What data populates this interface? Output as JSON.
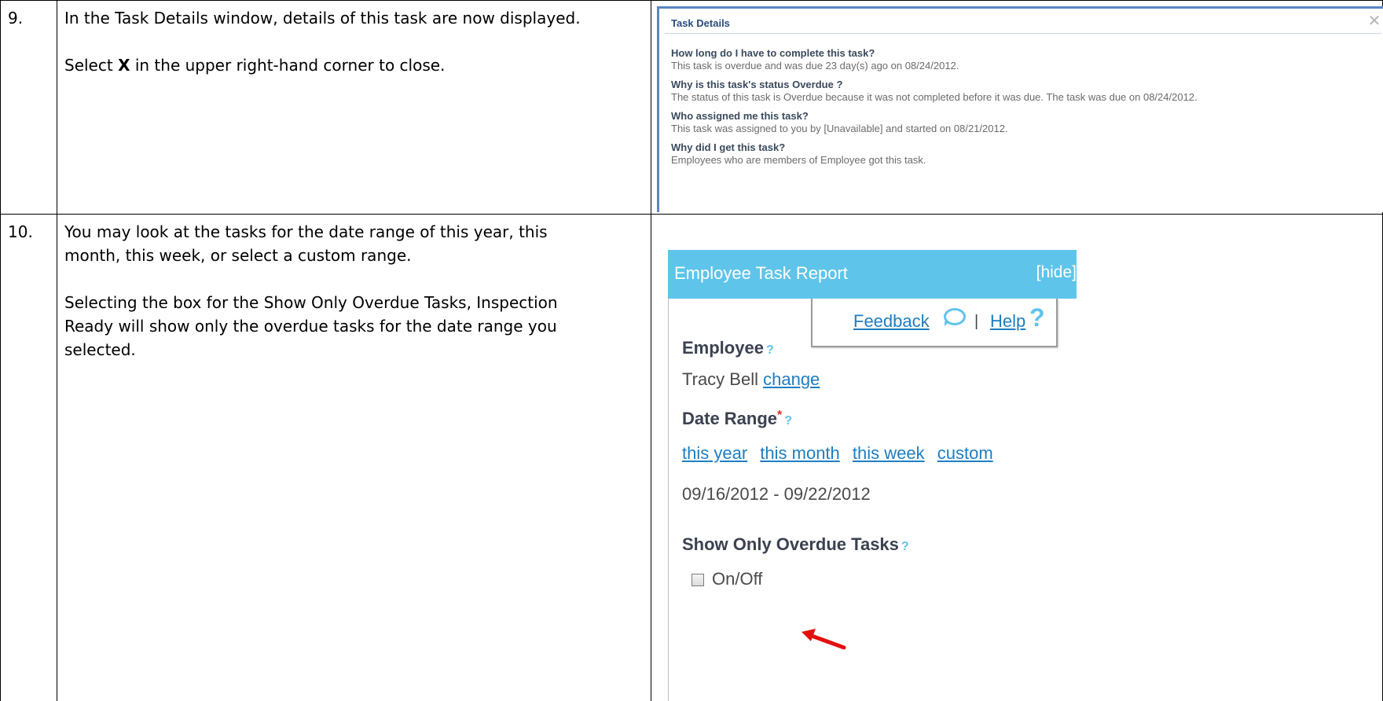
{
  "steps": [
    {
      "number": "9.",
      "paragraphs": [
        "In the Task Details window, details of this task are now displayed.",
        "in the upper right-hand corner to close."
      ],
      "bold_word": "X",
      "select_word": "Select"
    },
    {
      "number": "10.",
      "paragraphs": [
        "You may look at the tasks for the date range of this year, this month, this week, or select a custom range.",
        "Selecting the box for the Show Only Overdue Tasks, Inspection Ready will show only the overdue tasks for the date range you selected."
      ]
    }
  ],
  "task_details": {
    "title": "Task Details",
    "close_icon": "close-icon",
    "qa": [
      {
        "q": "How long do I have to complete this task?",
        "a": "This task is overdue and was due 23 day(s) ago on 08/24/2012."
      },
      {
        "q": "Why is this task's status  Overdue ?",
        "a": "The status of this task is Overdue because it was not completed before it was due. The task was due on 08/24/2012."
      },
      {
        "q": "Who assigned me this task?",
        "a": "This task was assigned to you by [Unavailable] and started on 08/21/2012."
      },
      {
        "q": "Why did I get this task?",
        "a": "Employees who are members of  Employee  got this task."
      }
    ]
  },
  "report": {
    "title": "Employee Task Report",
    "hide_label": "[hide]",
    "feedback_label": "Feedback",
    "separator": "|",
    "help_label": "Help",
    "help_mark": "?",
    "employee_label": "Employee",
    "employee_name": "Tracy Bell",
    "change_label": "change",
    "date_range_label": "Date Range",
    "required_mark": "*",
    "question_mark": "?",
    "range_options": [
      "this year",
      "this month",
      "this week",
      "custom"
    ],
    "date_range_value": "09/16/2012 - 09/22/2012",
    "overdue_label": "Show Only Overdue Tasks",
    "toggle_label": "On/Off",
    "header_color": "#5fc4ea",
    "link_color": "#1d7ec2",
    "arrow_color": "#e3100f"
  }
}
